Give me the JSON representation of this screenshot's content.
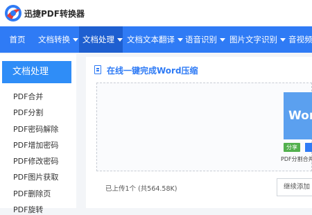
{
  "header": {
    "brand": "迅捷PDF转换器",
    "logo_colors": {
      "primary": "#2f7bf5",
      "accent": "#e23b3b"
    }
  },
  "nav": {
    "items": [
      {
        "label": "首页",
        "dropdown": false,
        "active": false
      },
      {
        "label": "文档转换",
        "dropdown": true,
        "active": false
      },
      {
        "label": "文档处理",
        "dropdown": true,
        "active": true
      },
      {
        "label": "文档文本翻译",
        "dropdown": true,
        "active": false
      },
      {
        "label": "语音识别",
        "dropdown": true,
        "active": false
      },
      {
        "label": "图片文字识别",
        "dropdown": true,
        "active": false
      },
      {
        "label": "音视频",
        "dropdown": false,
        "active": false
      }
    ],
    "bg_color": "#2f7bf5",
    "active_color": "#1e5fd0"
  },
  "sidebar": {
    "heading": "文档处理",
    "items": [
      {
        "label": "PDF合并"
      },
      {
        "label": "PDF分割"
      },
      {
        "label": "PDF密码解除"
      },
      {
        "label": "PDF增加密码"
      },
      {
        "label": "PDF修改密码"
      },
      {
        "label": "PDF图片获取"
      },
      {
        "label": "PDF删除页"
      },
      {
        "label": "PDF旋转"
      }
    ]
  },
  "main": {
    "title": "在线一键完成Word压缩",
    "file": {
      "thumb_text": "Wor",
      "share_label": "分享",
      "name": "PDF分割合并"
    },
    "upload_status": "已上传1个  (共564.58K)",
    "continue_label": "继续添加"
  }
}
